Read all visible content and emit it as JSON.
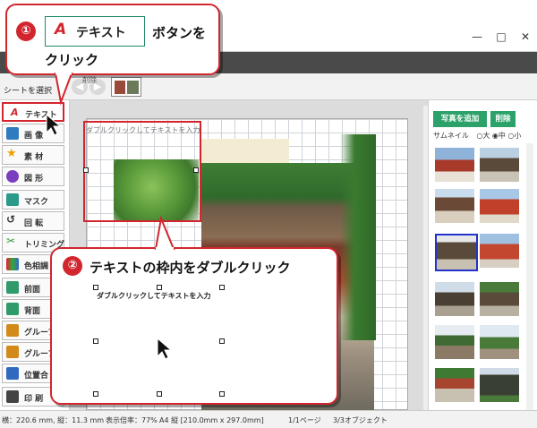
{
  "window": {
    "minimize_glyph": "—",
    "maximize_glyph": "□",
    "close_glyph": "✕"
  },
  "toolbar": {
    "select_label": "シートを選択",
    "delete_label": "削除",
    "back_glyph": "◀",
    "forward_glyph": "▶"
  },
  "tools": [
    {
      "label": "テキスト",
      "icon": "text-icon",
      "color": "#d2262f"
    },
    {
      "label": "画 像",
      "icon": "image-icon",
      "color": "#2f7bbf"
    },
    {
      "label": "素 材",
      "icon": "star-icon",
      "color": "#f0a000"
    },
    {
      "label": "図 形",
      "icon": "shape-icon",
      "color": "#7a3fbf"
    },
    {
      "label": "マスク",
      "icon": "mask-icon",
      "color": "#2a9a8a"
    },
    {
      "label": "回 転",
      "icon": "rotate-icon",
      "color": "#333333"
    },
    {
      "label": "トリミング",
      "icon": "trim-icon",
      "color": "#3a9a3a"
    },
    {
      "label": "色相調",
      "icon": "color-icon",
      "color": "#c03a3a"
    },
    {
      "label": "前面",
      "icon": "front-icon",
      "color": "#2f9a6a"
    },
    {
      "label": "背面",
      "icon": "back-icon",
      "color": "#2f9a6a"
    },
    {
      "label": "グループ",
      "icon": "group-icon",
      "color": "#d28a1a"
    },
    {
      "label": "グループ",
      "icon": "ungroup-icon",
      "color": "#d28a1a"
    },
    {
      "label": "位置合",
      "icon": "align-icon",
      "color": "#2f6abf"
    },
    {
      "label": "印 刷",
      "icon": "print-icon",
      "color": "#333333"
    }
  ],
  "canvas": {
    "placeholder_text": "ダブルクリックしてテキストを入力"
  },
  "right_panel": {
    "add_photo_label": "写真を追加",
    "delete_label": "削除",
    "thumbnail_label": "サムネイル",
    "size_options": [
      "○大",
      "◉中",
      "○小"
    ]
  },
  "status": {
    "position": "横：220.6 mm, 縦：11.3 mm",
    "zoom": "表示倍率：77%",
    "paper": "A4 縦 [210.0mm x 297.0mm]",
    "page": "1/1ページ",
    "objects": "3/3オブジェクト"
  },
  "callout1": {
    "number": "①",
    "chip_label": "テキスト",
    "chip_icon_glyph": "A",
    "text_after": "ボタンを",
    "text_line2": "クリック"
  },
  "callout2": {
    "number": "②",
    "text": "テキストの枠内をダブルクリック",
    "inner_text": "ダブルクリックしてテキストを入力"
  },
  "colors": {
    "accent_red": "#d2262f",
    "accent_green": "#2ca26a"
  }
}
